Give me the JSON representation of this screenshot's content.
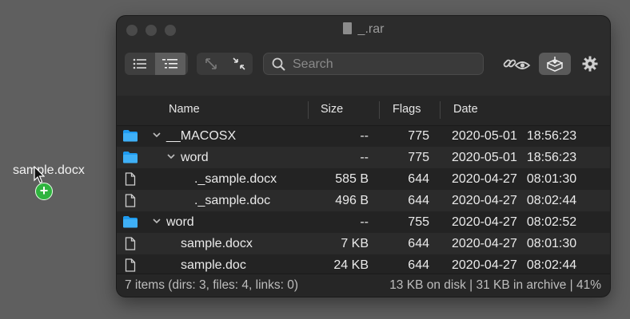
{
  "desktop": {
    "drag_label": "sample.docx"
  },
  "window": {
    "title": "_.rar",
    "search": {
      "placeholder": "Search",
      "value": ""
    }
  },
  "columns": {
    "name": "Name",
    "size": "Size",
    "flags": "Flags",
    "date": "Date"
  },
  "rows": [
    {
      "type": "folder",
      "expanded": true,
      "depth": 0,
      "name": "__MACOSX",
      "size": "--",
      "flags": "775",
      "date": "2020-05-01",
      "time": "18:56:23"
    },
    {
      "type": "folder",
      "expanded": true,
      "depth": 1,
      "name": "word",
      "size": "--",
      "flags": "775",
      "date": "2020-05-01",
      "time": "18:56:23"
    },
    {
      "type": "file",
      "depth": 2,
      "name": "._sample.docx",
      "size": "585 B",
      "flags": "644",
      "date": "2020-04-27",
      "time": "08:01:30"
    },
    {
      "type": "file",
      "depth": 2,
      "name": "._sample.doc",
      "size": "496 B",
      "flags": "644",
      "date": "2020-04-27",
      "time": "08:02:44"
    },
    {
      "type": "folder",
      "expanded": true,
      "depth": 0,
      "name": "word",
      "size": "--",
      "flags": "755",
      "date": "2020-04-27",
      "time": "08:02:52"
    },
    {
      "type": "file",
      "depth": 1,
      "name": "sample.docx",
      "size": "7 KB",
      "flags": "644",
      "date": "2020-04-27",
      "time": "08:01:30"
    },
    {
      "type": "file",
      "depth": 1,
      "name": "sample.doc",
      "size": "24 KB",
      "flags": "644",
      "date": "2020-04-27",
      "time": "08:02:44"
    }
  ],
  "status": {
    "left": "7 items (dirs: 3, files: 4, links: 0)",
    "right": "13 KB on disk | 31 KB in archive | 41%"
  },
  "colors": {
    "folder": "#1e9bf0",
    "add_badge": "#2fb43f"
  },
  "icons": [
    "list-view-icon",
    "outline-view-icon",
    "expand-icon",
    "collapse-icon",
    "search-icon",
    "link-eye-icon",
    "extract-icon",
    "gear-icon",
    "folder-icon",
    "file-icon",
    "chevron-down-icon",
    "plus-icon"
  ]
}
